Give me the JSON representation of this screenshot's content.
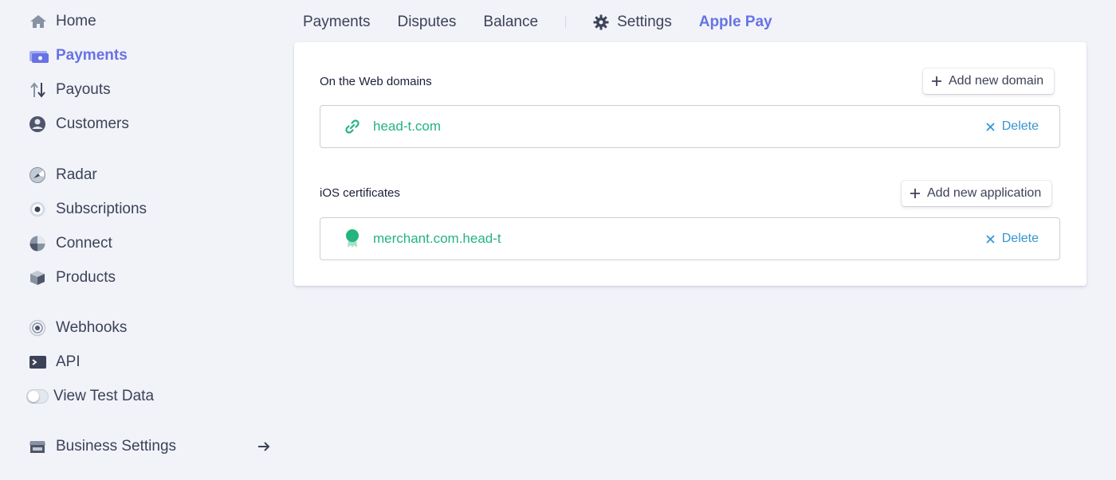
{
  "sidebar": {
    "items": [
      {
        "label": "Home",
        "icon": "home-icon"
      },
      {
        "label": "Payments",
        "icon": "payments-icon",
        "active": true
      },
      {
        "label": "Payouts",
        "icon": "payouts-icon"
      },
      {
        "label": "Customers",
        "icon": "customers-icon"
      },
      {
        "label": "Radar",
        "icon": "radar-icon"
      },
      {
        "label": "Subscriptions",
        "icon": "subscriptions-icon"
      },
      {
        "label": "Connect",
        "icon": "connect-icon"
      },
      {
        "label": "Products",
        "icon": "products-icon"
      },
      {
        "label": "Webhooks",
        "icon": "webhooks-icon"
      },
      {
        "label": "API",
        "icon": "api-icon"
      }
    ],
    "test_data_label": "View Test Data",
    "test_data_enabled": false,
    "business_settings_label": "Business Settings"
  },
  "tabs": {
    "payments": "Payments",
    "disputes": "Disputes",
    "balance": "Balance",
    "settings": "Settings",
    "apple_pay": "Apple Pay"
  },
  "web_domains": {
    "title": "On the Web domains",
    "add_label": "Add new domain",
    "items": [
      {
        "name": "head-t.com",
        "delete_label": "Delete"
      }
    ]
  },
  "ios_certificates": {
    "title": "iOS certificates",
    "add_label": "Add new application",
    "items": [
      {
        "name": "merchant.com.head-t",
        "delete_label": "Delete"
      }
    ]
  },
  "colors": {
    "accent": "#6772e5",
    "success": "#24b47e",
    "link": "#3297d3",
    "background": "#f1f3f9"
  }
}
